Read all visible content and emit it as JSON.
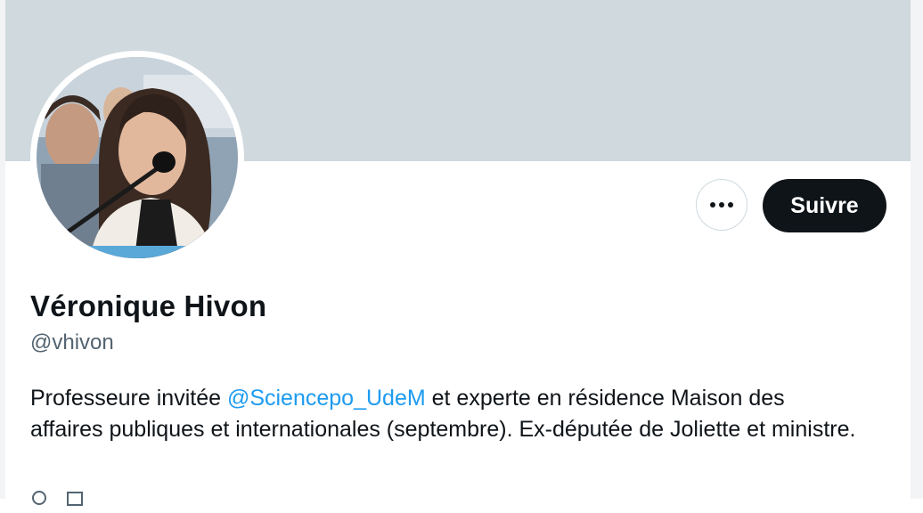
{
  "profile": {
    "name": "Véronique Hivon",
    "handle": "@vhivon",
    "bio": {
      "before": "Professeure invitée ",
      "mention": "@Sciencepo_UdeM",
      "after": " et experte en résidence Maison des affaires publiques et internationales (septembre). Ex-députée de Joliette et ministre."
    },
    "meta": {
      "link_icon": "link-icon",
      "link_text": "",
      "joined_icon": "calendar-icon",
      "joined_text": ""
    }
  },
  "actions": {
    "more_icon": "more-icon",
    "follow_label": "Suivre"
  },
  "colors": {
    "banner": "#cfd9de",
    "accent": "#1d9bf0",
    "follow_bg": "#0f1419"
  }
}
